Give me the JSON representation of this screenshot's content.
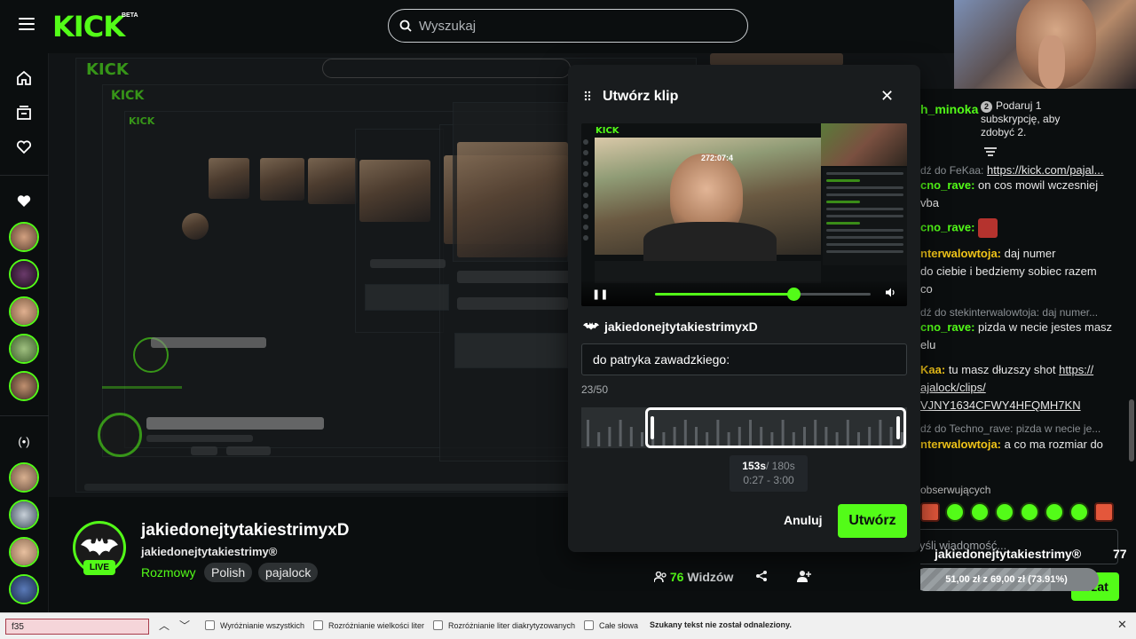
{
  "app": {
    "logo": "KICK",
    "logo_badge": "BETA"
  },
  "search": {
    "placeholder": "Wyszukaj"
  },
  "streamer": {
    "display_name": "jakiedonejtytakiestrimyxD",
    "stream_title": "jakiedonejtytakiestrimy®",
    "category": "Rozmowy",
    "tags": [
      "Polish",
      "pajalock"
    ],
    "live_badge": "LIVE",
    "viewers_count": "76",
    "viewers_label": "Widzów"
  },
  "modal": {
    "title": "Utwórz klip",
    "preview_timer": "272:07:4",
    "preview_logo": "KICK",
    "owner": "jakiedonejtytakiestrimyxD",
    "title_value": "do patryka zawadzkiego:",
    "char_counter": "23/50",
    "duration_selected": "153s",
    "duration_max": "/ 180s",
    "range": "0:27 - 3:00",
    "cancel_label": "Anuluj",
    "create_label": "Utwórz",
    "preview_progress": 0.64,
    "selection_start": 0.2,
    "selection_end": 1.0
  },
  "chat": {
    "header_user": "h_minoka",
    "gift_count": "2",
    "gift_text": "Podaruj 1 subskrypcję, aby zdobyć 2.",
    "messages": [
      {
        "reply": "dź do FeKaa:",
        "link": "https://kick.com/pajal..."
      },
      {
        "user": "cno_rave:",
        "text": "on cos mowil wczesniej",
        "extra": "vba"
      },
      {
        "user": "cno_rave:",
        "text": ""
      },
      {
        "user": "nterwalowtoja:",
        "text": "daj numer",
        "extra1": "do ciebie i bedziemy sobiec razem",
        "extra2": "co"
      },
      {
        "reply": "dź do stekinterwalowtoja: daj numer..."
      },
      {
        "user": "cno_rave:",
        "text": "pizda w necie jestes masz",
        "extra": "elu"
      },
      {
        "user": "Kaa:",
        "text": "tu masz dłuzszy shot",
        "link1": "https://",
        "link2": "ajalock/clips/",
        "link3": "VJNY1634CFWY4HFQMH7KN"
      },
      {
        "reply": "dź do Techno_rave: pizda w necie je..."
      },
      {
        "user": "nterwalowtoja:",
        "text": "a co ma rozmiar do"
      }
    ],
    "followers_label": "obserwujących",
    "input_placeholder": "yśli wiadomość...",
    "send_label": "Czat"
  },
  "overlay": {
    "channel": "jakiedonejtytakiestrimy®",
    "count": "77",
    "goal_text": "51,00 zł z 69,00 zł (73.91%)",
    "goal_fraction": 0.7391
  },
  "findbar": {
    "query": "f35",
    "options": [
      "Wyróżnianie wszystkich",
      "Rozróżnianie wielkości liter",
      "Rozróżnianie liter diakrytyzowanych",
      "Całe słowa"
    ],
    "status": "Szukany tekst nie został odnaleziony."
  },
  "colors": {
    "accent": "#53fc18",
    "background": "#0b0e0f",
    "modal": "#191c1e"
  }
}
